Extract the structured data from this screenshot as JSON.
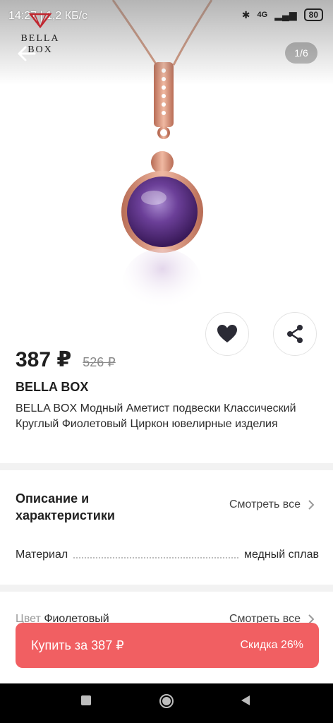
{
  "status_bar": {
    "time": "14:27 | 1,2 КБ/с",
    "network": "4G",
    "battery": "80"
  },
  "brand_logo": "BELLA BOX",
  "gallery": {
    "counter": "1/6"
  },
  "product": {
    "price": "387 ₽",
    "old_price": "526 ₽",
    "brand": "BELLA BOX",
    "title": "BELLA BOX Модный Аметист подвески Классический Круглый Фиолетовый Циркон ювелирные изделия"
  },
  "description": {
    "heading": "Описание и характеристики",
    "see_all": "Смотреть все",
    "spec_label": "Материал",
    "spec_value": "медный сплав"
  },
  "color_section": {
    "label": "Цвет",
    "value": "Фиолетовый",
    "see_all": "Смотреть все"
  },
  "buy_button": {
    "label": "Купить за 387 ₽",
    "discount": "Скидка 26%"
  },
  "icons": {
    "back": "arrow-left-icon",
    "favorite": "heart-icon",
    "share": "share-icon"
  },
  "colors": {
    "accent": "#f15f62",
    "gem": "#7b4a9e",
    "gold": "#d9917a"
  }
}
